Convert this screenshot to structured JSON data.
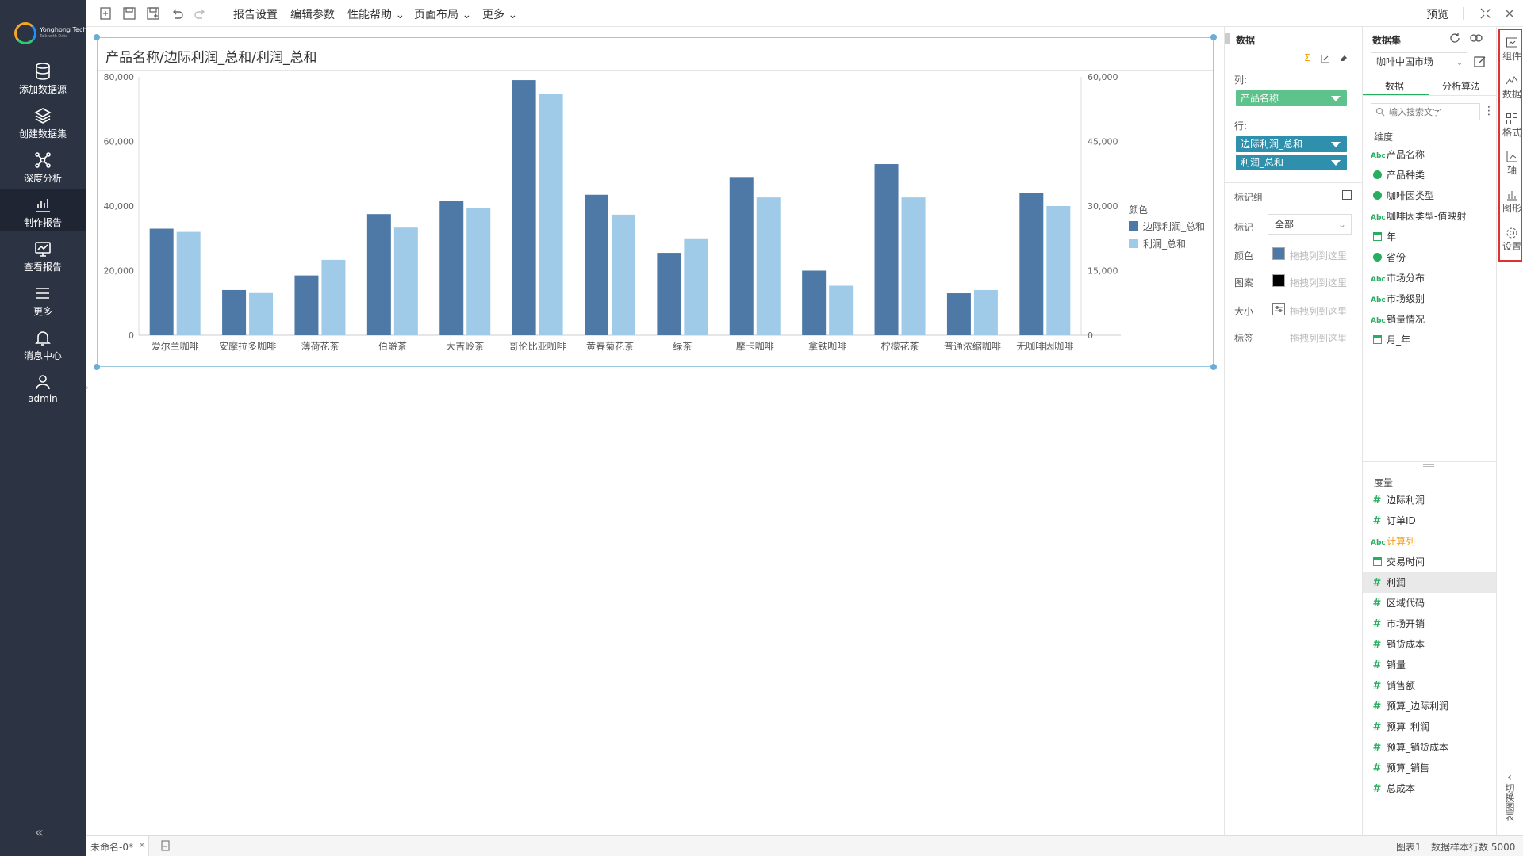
{
  "nav": {
    "items": [
      {
        "label": "添加数据源",
        "icon": "database-icon"
      },
      {
        "label": "创建数据集",
        "icon": "layers-icon"
      },
      {
        "label": "深度分析",
        "icon": "network-icon"
      },
      {
        "label": "制作报告",
        "icon": "bar-chart-icon"
      },
      {
        "label": "查看报告",
        "icon": "monitor-icon"
      },
      {
        "label": "更多",
        "icon": "menu-icon"
      },
      {
        "label": "消息中心",
        "icon": "bell-icon"
      },
      {
        "label": "admin",
        "icon": "user-icon"
      }
    ],
    "logo_text": "Yonghong Tech",
    "logo_sub": "Talk with Data",
    "collapse": "«"
  },
  "toolbar": {
    "menus": [
      "报告设置",
      "编辑参数",
      "性能帮助 ⌄",
      "页面布局 ⌄",
      "更多 ⌄"
    ],
    "preview": "预览"
  },
  "chart": {
    "title": "产品名称/边际利润_总和/利润_总和",
    "legend_title": "颜色",
    "colors": {
      "s1": "#4e79a7",
      "s2": "#a0cbe8"
    }
  },
  "chart_data": {
    "type": "bar",
    "title": "产品名称/边际利润_总和/利润_总和",
    "categories": [
      "爱尔兰咖啡",
      "安摩拉多咖啡",
      "薄荷花茶",
      "伯爵茶",
      "大吉岭茶",
      "哥伦比亚咖啡",
      "黄春菊花茶",
      "绿茶",
      "摩卡咖啡",
      "拿铁咖啡",
      "柠檬花茶",
      "普通浓缩咖啡",
      "无咖啡因咖啡"
    ],
    "series": [
      {
        "name": "边际利润_总和",
        "axis": "left",
        "values": [
          33000,
          14000,
          18500,
          37500,
          41500,
          79000,
          43500,
          25500,
          49000,
          20000,
          53000,
          13000,
          44000
        ]
      },
      {
        "name": "利润_总和",
        "axis": "right",
        "values": [
          24000,
          9800,
          17500,
          25000,
          29500,
          56000,
          28000,
          22500,
          32000,
          11500,
          32000,
          10500,
          30000
        ]
      }
    ],
    "ylim": [
      0,
      80000
    ],
    "yticks": [
      "80,000",
      "60,000",
      "40,000",
      "20,000",
      "0"
    ],
    "y2lim": [
      0,
      60000
    ],
    "y2ticks": [
      "60,000",
      "45,000",
      "30,000",
      "15,000",
      "0"
    ],
    "legend": "right",
    "grid": false
  },
  "datapanel": {
    "title": "数据",
    "col_label": "列:",
    "col_pill": "产品名称",
    "row_label": "行:",
    "row_pills": [
      "边际利润_总和",
      "利润_总和"
    ],
    "markgroup": "标记组",
    "mark_label": "标记",
    "mark_value": "全部",
    "props": [
      {
        "label": "颜色",
        "hint": "拖拽列到这里"
      },
      {
        "label": "图案",
        "hint": "拖拽列到这里"
      },
      {
        "label": "大小",
        "hint": "拖拽列到这里"
      },
      {
        "label": "标签",
        "hint": "拖拽列到这里"
      }
    ]
  },
  "dataset": {
    "title": "数据集",
    "selected": "咖啡中国市场",
    "tabs": [
      "数据",
      "分析算法"
    ],
    "search_placeholder": "输入搜索文字",
    "dim_title": "维度",
    "dims": [
      {
        "name": "产品名称",
        "type": "abc"
      },
      {
        "name": "产品种类",
        "type": "globe"
      },
      {
        "name": "咖啡因类型",
        "type": "globe"
      },
      {
        "name": "咖啡因类型-值映射",
        "type": "abc"
      },
      {
        "name": "年",
        "type": "cal"
      },
      {
        "name": "省份",
        "type": "globe"
      },
      {
        "name": "市场分布",
        "type": "abc"
      },
      {
        "name": "市场级别",
        "type": "abc"
      },
      {
        "name": "销量情况",
        "type": "abc"
      },
      {
        "name": "月_年",
        "type": "cal"
      }
    ],
    "measure_title": "度量",
    "measures": [
      {
        "name": "边际利润",
        "type": "hash"
      },
      {
        "name": "订单ID",
        "type": "hash"
      },
      {
        "name": "计算列",
        "type": "abc"
      },
      {
        "name": "交易时间",
        "type": "cal"
      },
      {
        "name": "利润",
        "type": "hash"
      },
      {
        "name": "区域代码",
        "type": "hash"
      },
      {
        "name": "市场开销",
        "type": "hash"
      },
      {
        "name": "销货成本",
        "type": "hash"
      },
      {
        "name": "销量",
        "type": "hash"
      },
      {
        "name": "销售额",
        "type": "hash"
      },
      {
        "name": "预算_边际利润",
        "type": "hash"
      },
      {
        "name": "预算_利润",
        "type": "hash"
      },
      {
        "name": "预算_销货成本",
        "type": "hash"
      },
      {
        "name": "预算_销售",
        "type": "hash"
      },
      {
        "name": "总成本",
        "type": "hash"
      }
    ],
    "computed_color": "#f39c12"
  },
  "rail": {
    "items": [
      "组件",
      "数据",
      "格式",
      "轴",
      "图形",
      "设置"
    ],
    "switch_label": "切换图表"
  },
  "status": {
    "tab": "未命名-0*",
    "chart_name": "图表1",
    "sample": "数据样本行数 5000"
  }
}
